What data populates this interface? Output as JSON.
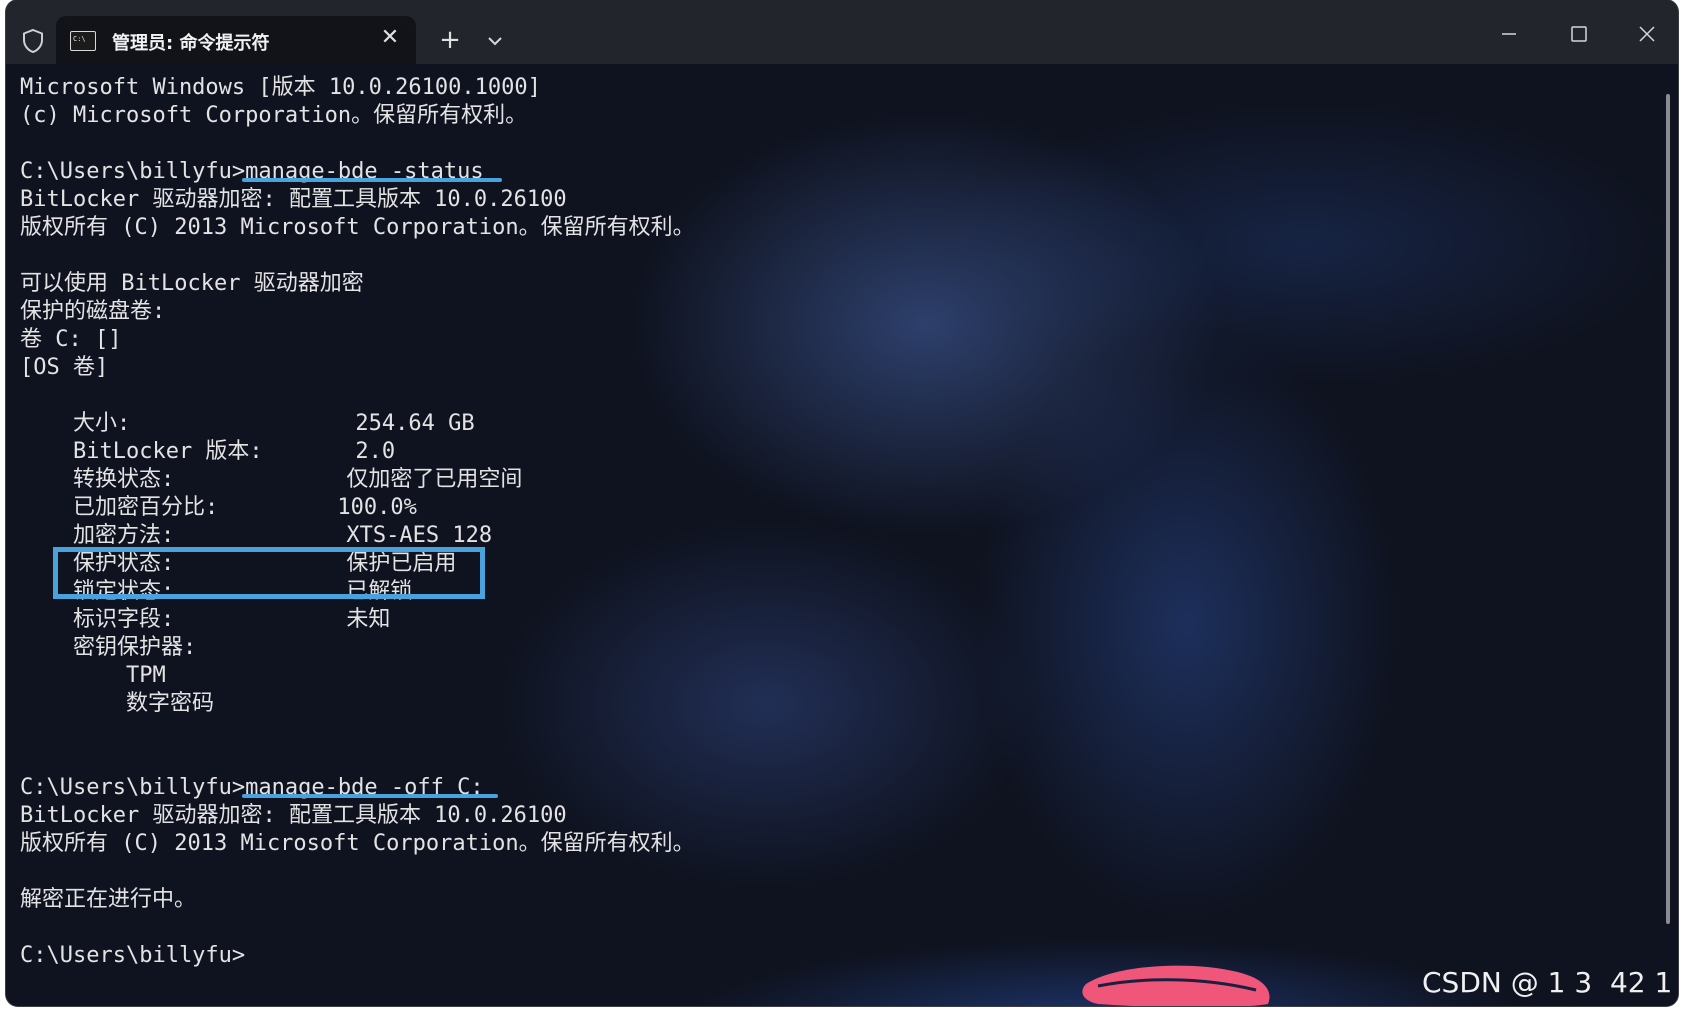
{
  "titlebar": {
    "tab_title": "管理员: 命令提示符",
    "new_tab_label": "+",
    "close_tab_label": "✕"
  },
  "terminal": {
    "lines": [
      "Microsoft Windows [版本 10.0.26100.1000]",
      "(c) Microsoft Corporation。保留所有权利。",
      "",
      "C:\\Users\\billyfu>manage-bde -status",
      "BitLocker 驱动器加密: 配置工具版本 10.0.26100",
      "版权所有 (C) 2013 Microsoft Corporation。保留所有权利。",
      "",
      "可以使用 BitLocker 驱动器加密",
      "保护的磁盘卷:",
      "卷 C: []",
      "[OS 卷]",
      "",
      "    大小:                 254.64 GB",
      "    BitLocker 版本:       2.0",
      "    转换状态:             仅加密了已用空间",
      "    已加密百分比:         100.0%",
      "    加密方法:             XTS-AES 128",
      "    保护状态:             保护已启用",
      "    锁定状态:             已解锁",
      "    标识字段:             未知",
      "    密钥保护器:",
      "        TPM",
      "        数字密码",
      "",
      "",
      "C:\\Users\\billyfu>manage-bde -off C:",
      "BitLocker 驱动器加密: 配置工具版本 10.0.26100",
      "版权所有 (C) 2013 Microsoft Corporation。保留所有权利。",
      "",
      "解密正在进行中。",
      "",
      "C:\\Users\\billyfu>"
    ]
  },
  "watermark": "CSDN @ 1 3  42 1",
  "colors": {
    "titlebar_bg": "#23252c",
    "tab_bg": "#111318",
    "terminal_bg": "#0f1320",
    "terminal_text": "#e3e3e3",
    "annotation_blue": "#4aa2dc",
    "redaction_red": "#f0557a"
  }
}
